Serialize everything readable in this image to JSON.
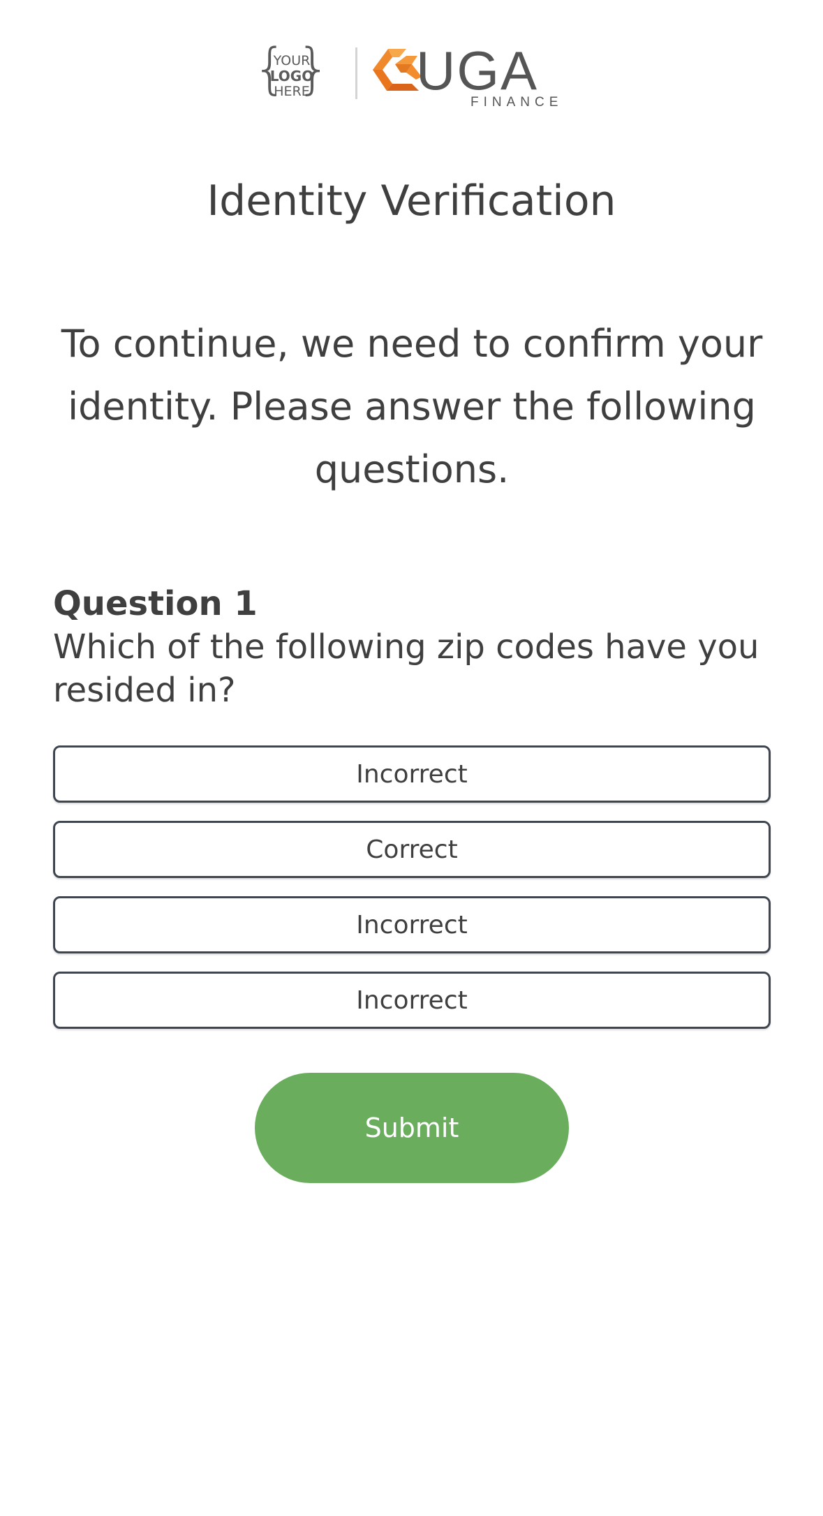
{
  "header": {
    "placeholder_logo": {
      "line1": "YOUR",
      "line2": "LOGO",
      "line3": "HERE",
      "icon": "logo-placeholder-icon"
    },
    "brand": {
      "name": "UGA",
      "subtitle": "FINANCE",
      "icon": "uga-finance-logo-icon",
      "accent_color": "#f0892b",
      "text_color": "#555555"
    }
  },
  "page": {
    "title": "Identity Verification",
    "intro": "To continue, we need to confirm your identity. Please answer the following questions."
  },
  "question": {
    "label": "Question 1",
    "text": "Which of the following zip codes have you resided in?",
    "options": [
      {
        "label": "Incorrect"
      },
      {
        "label": "Correct"
      },
      {
        "label": "Incorrect"
      },
      {
        "label": "Incorrect"
      }
    ]
  },
  "actions": {
    "submit_label": "Submit",
    "submit_color": "#6aae5d"
  }
}
